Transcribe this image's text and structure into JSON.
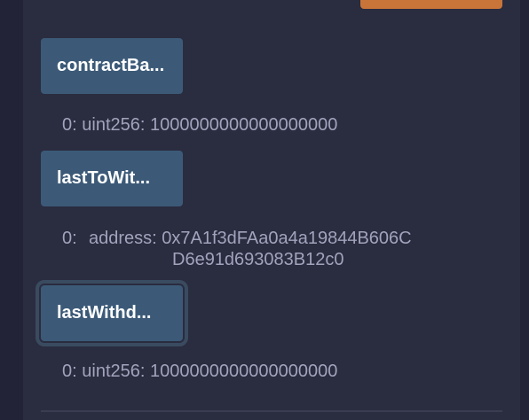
{
  "functions": [
    {
      "label": "contractBa...",
      "result": {
        "index": "0:",
        "text": "uint256: 1000000000000000000"
      }
    },
    {
      "label": "lastToWit...",
      "result": {
        "index": "0:",
        "type_label": "address: ",
        "line1": "0x7A1f3dFAa0a4a19844B606C",
        "line2": "D6e91d693083B12c0"
      }
    },
    {
      "label": "lastWithd...",
      "result": {
        "index": "0:",
        "text": "uint256: 1000000000000000000"
      }
    }
  ],
  "colors": {
    "background": "#2a2c3f",
    "button": "#3c5a78",
    "accent_orange": "#c97539",
    "result_text": "#a2a3bd"
  }
}
